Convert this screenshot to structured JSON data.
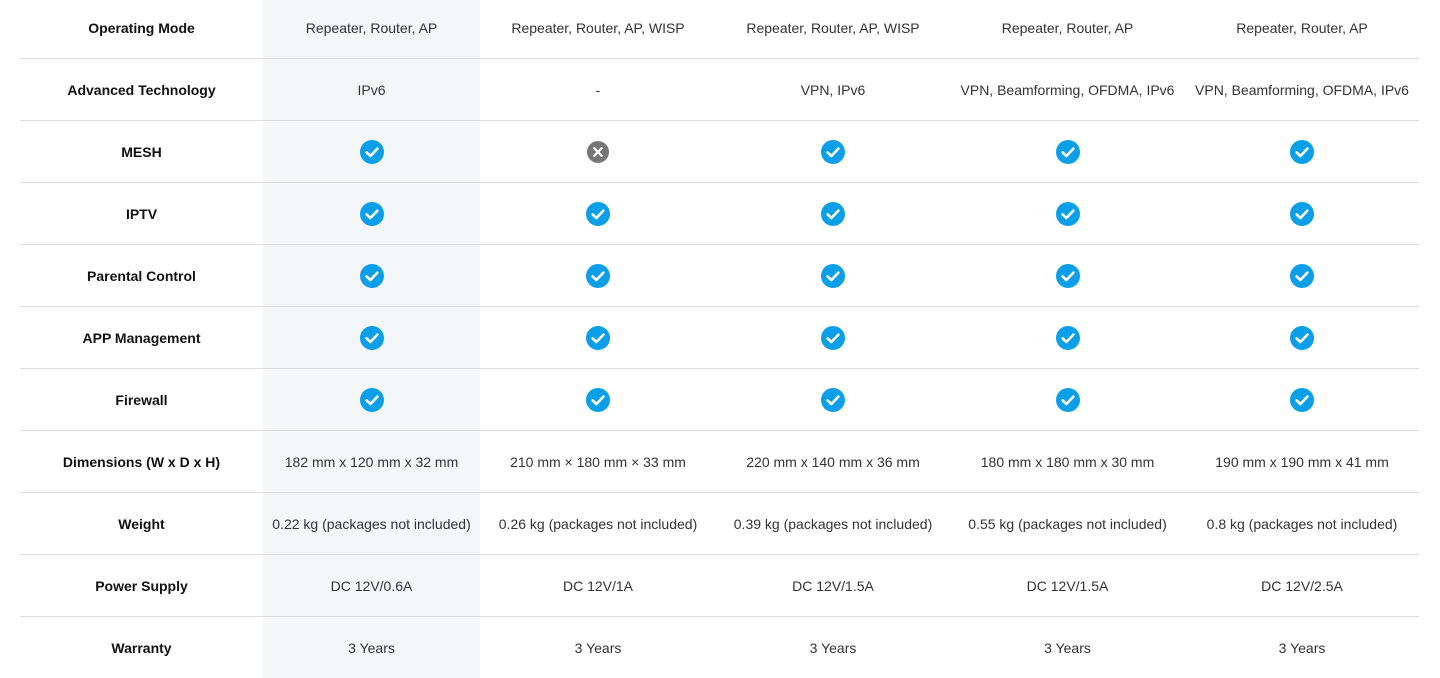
{
  "colors": {
    "check": "#0a9fe8",
    "cross": "#777777",
    "highlight_column": "#f5f6f8",
    "divider": "#dedede"
  },
  "rows": [
    {
      "label": "Operating Mode",
      "type": "text",
      "cells": [
        "Repeater, Router, AP",
        "Repeater, Router, AP, WISP",
        "Repeater, Router, AP, WISP",
        "Repeater, Router, AP",
        "Repeater, Router, AP"
      ]
    },
    {
      "label": "Advanced Technology",
      "type": "text",
      "cells": [
        "IPv6",
        "-",
        "VPN, IPv6",
        "VPN, Beamforming, OFDMA, IPv6",
        "VPN, Beamforming, OFDMA, IPv6"
      ]
    },
    {
      "label": "MESH",
      "type": "icon",
      "cells": [
        "check-circle-icon",
        "cross-circle-icon",
        "check-circle-icon",
        "check-circle-icon",
        "check-circle-icon"
      ]
    },
    {
      "label": "IPTV",
      "type": "icon",
      "cells": [
        "check-circle-icon",
        "check-circle-icon",
        "check-circle-icon",
        "check-circle-icon",
        "check-circle-icon"
      ]
    },
    {
      "label": "Parental Control",
      "type": "icon",
      "cells": [
        "check-circle-icon",
        "check-circle-icon",
        "check-circle-icon",
        "check-circle-icon",
        "check-circle-icon"
      ]
    },
    {
      "label": "APP Management",
      "type": "icon",
      "cells": [
        "check-circle-icon",
        "check-circle-icon",
        "check-circle-icon",
        "check-circle-icon",
        "check-circle-icon"
      ]
    },
    {
      "label": "Firewall",
      "type": "icon",
      "cells": [
        "check-circle-icon",
        "check-circle-icon",
        "check-circle-icon",
        "check-circle-icon",
        "check-circle-icon"
      ]
    },
    {
      "label": "Dimensions (W x D x H)",
      "type": "text",
      "cells": [
        "182 mm x 120 mm x 32 mm",
        "210 mm × 180 mm × 33 mm",
        "220 mm x 140 mm x 36 mm",
        "180 mm x 180 mm x 30 mm",
        "190 mm x 190 mm x 41 mm"
      ]
    },
    {
      "label": "Weight",
      "type": "text",
      "cells": [
        "0.22 kg (packages not included)",
        "0.26 kg (packages not included)",
        "0.39 kg (packages not included)",
        "0.55 kg (packages not included)",
        "0.8 kg (packages not included)"
      ]
    },
    {
      "label": "Power Supply",
      "type": "text",
      "cells": [
        "DC 12V/0.6A",
        "DC 12V/1A",
        "DC 12V/1.5A",
        "DC 12V/1.5A",
        "DC 12V/2.5A"
      ]
    },
    {
      "label": "Warranty",
      "type": "text",
      "cells": [
        "3 Years",
        "3 Years",
        "3 Years",
        "3 Years",
        "3 Years"
      ]
    }
  ]
}
